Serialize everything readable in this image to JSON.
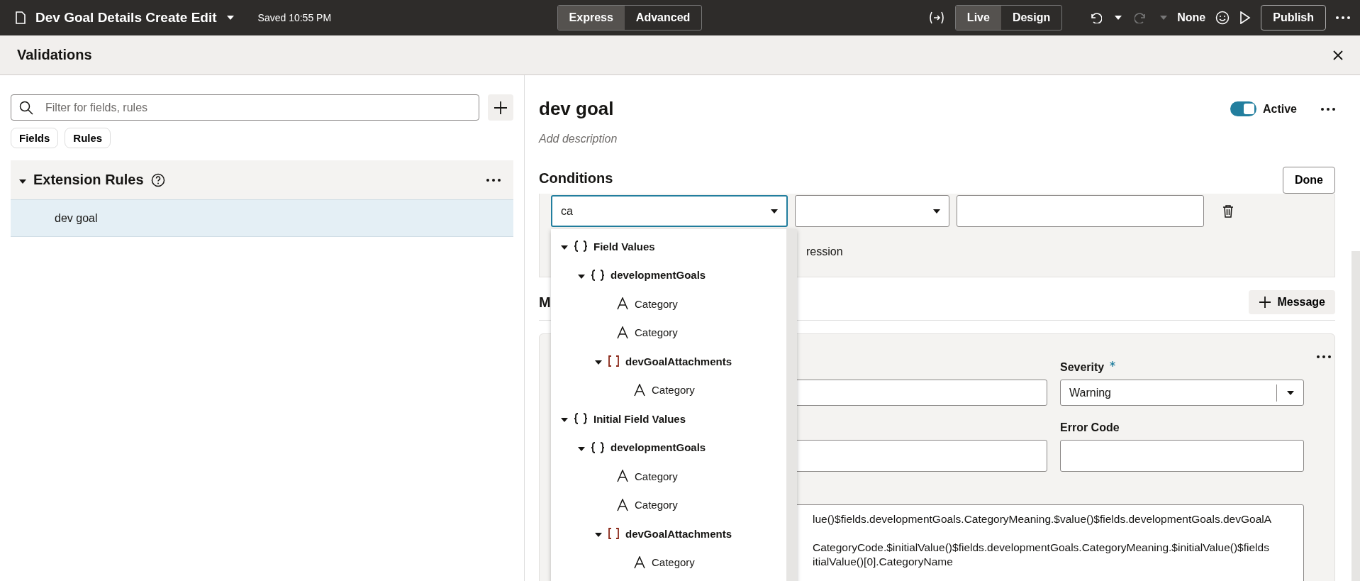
{
  "top_bar": {
    "title": "Dev Goal Details Create Edit",
    "saved": "Saved 10:55 PM",
    "modes": [
      {
        "label": "Express",
        "selected": true
      },
      {
        "label": "Advanced",
        "selected": false
      }
    ],
    "views": [
      {
        "label": "Live",
        "selected": true
      },
      {
        "label": "Design",
        "selected": false
      }
    ],
    "redo_disabled": true,
    "profile": "None",
    "publish": "Publish"
  },
  "dialog": {
    "title": "Validations"
  },
  "left": {
    "search": {
      "placeholder": "Filter for fields, rules"
    },
    "chips": [
      {
        "label": "Fields"
      },
      {
        "label": "Rules"
      }
    ],
    "group": {
      "title": "Extension Rules",
      "expanded": true,
      "items": [
        {
          "label": "dev goal",
          "selected": true
        }
      ]
    }
  },
  "rule": {
    "title": "dev goal",
    "description_placeholder": "Add description",
    "active": {
      "label": "Active",
      "on": true
    },
    "conditions": {
      "title": "Conditions",
      "done": "Done",
      "field_value": "ca",
      "partial_text": "ression",
      "dropdown": [
        {
          "label": "Field Values",
          "kind": "object",
          "expanded": true,
          "children": [
            {
              "label": "developmentGoals",
              "kind": "object",
              "expanded": true,
              "children": [
                {
                  "label": "Category",
                  "kind": "string"
                },
                {
                  "label": "Category",
                  "kind": "string"
                },
                {
                  "label": "devGoalAttachments",
                  "kind": "array",
                  "expanded": true,
                  "children": [
                    {
                      "label": "Category",
                      "kind": "string"
                    }
                  ]
                }
              ]
            }
          ]
        },
        {
          "label": "Initial Field Values",
          "kind": "object",
          "expanded": true,
          "children": [
            {
              "label": "developmentGoals",
              "kind": "object",
              "expanded": true,
              "children": [
                {
                  "label": "Category",
                  "kind": "string"
                },
                {
                  "label": "Category",
                  "kind": "string"
                },
                {
                  "label": "devGoalAttachments",
                  "kind": "array",
                  "expanded": true,
                  "children": [
                    {
                      "label": "Category",
                      "kind": "string"
                    }
                  ]
                }
              ]
            }
          ]
        }
      ]
    },
    "messages": {
      "title_visible": "M",
      "add": "Message",
      "severity": {
        "label": "Severity",
        "required": true,
        "value": "Warning"
      },
      "error_code": {
        "label": "Error Code"
      },
      "expression_paragraphs": [
        [
          "lue()$fields.developmentGoals.CategoryMeaning.$value()$fields.developmentGoals.devGoalA"
        ],
        [
          "CategoryCode.$initialValue()$fields.developmentGoals.CategoryMeaning.$initialValue()$fields",
          "itialValue()[0].CategoryName"
        ]
      ]
    }
  }
}
